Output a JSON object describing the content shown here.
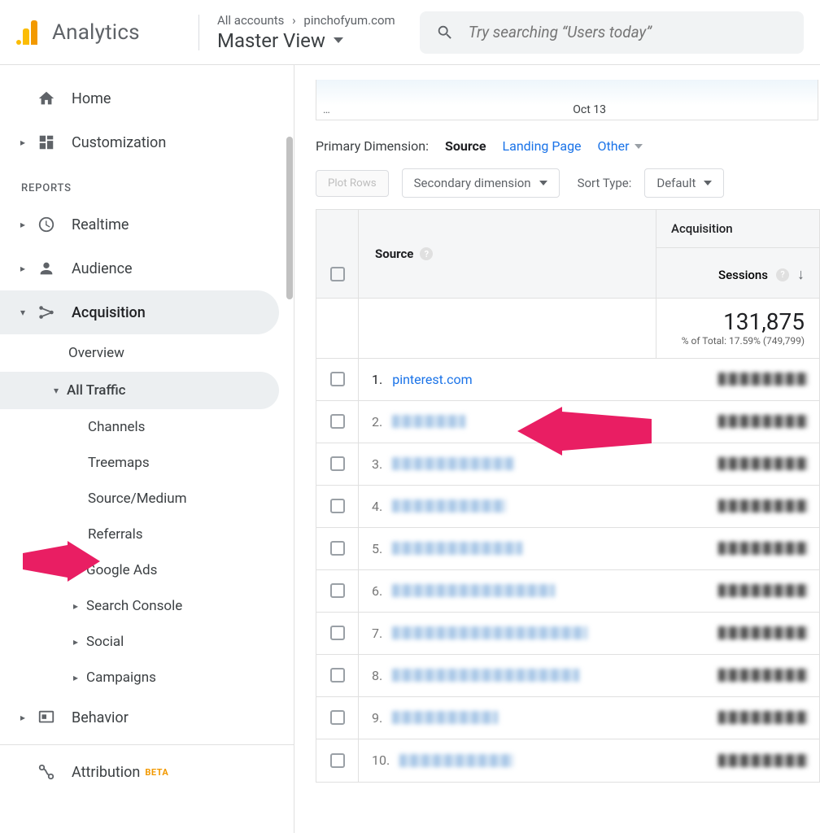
{
  "header": {
    "brand": "Analytics",
    "breadcrumb_a": "All accounts",
    "breadcrumb_b": "pinchofyum.com",
    "view": "Master View",
    "search_placeholder": "Try searching “Users today”"
  },
  "sidebar": {
    "home": "Home",
    "customization": "Customization",
    "reports_label": "REPORTS",
    "realtime": "Realtime",
    "audience": "Audience",
    "acquisition": "Acquisition",
    "acq_children": {
      "overview": "Overview",
      "all_traffic": "All Traffic",
      "channels": "Channels",
      "treemaps": "Treemaps",
      "source_medium": "Source/Medium",
      "referrals": "Referrals",
      "google_ads": "Google Ads",
      "search_console": "Search Console",
      "social": "Social",
      "campaigns": "Campaigns"
    },
    "behavior": "Behavior",
    "attribution": "Attribution",
    "beta": "BETA"
  },
  "main": {
    "chart_date": "Oct 13",
    "prim_dim_label": "Primary Dimension:",
    "prim_dim_current": "Source",
    "prim_dim_landing": "Landing Page",
    "prim_dim_other": "Other",
    "plot_rows": "Plot Rows",
    "secondary_dim": "Secondary dimension",
    "sort_type_label": "Sort Type:",
    "sort_default": "Default",
    "th_source": "Source",
    "th_group": "Acquisition",
    "th_sessions": "Sessions",
    "total_sessions": "131,875",
    "total_pct": "% of Total: 17.59% (749,799)",
    "row1_index": "1.",
    "row1_source": "pinterest.com"
  }
}
